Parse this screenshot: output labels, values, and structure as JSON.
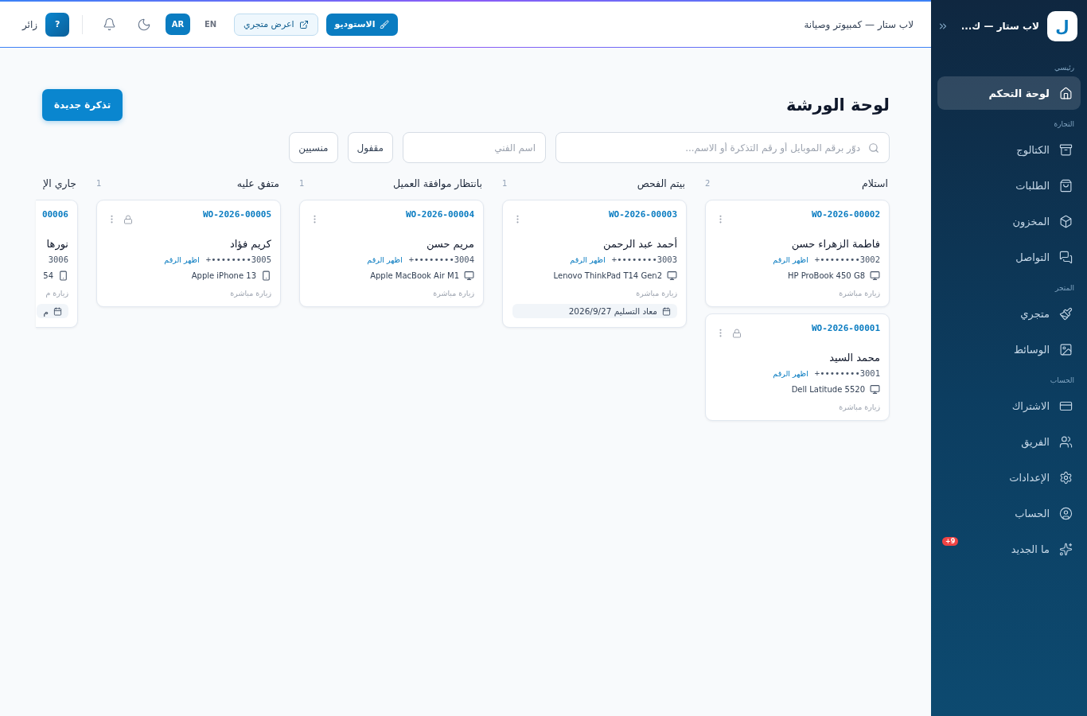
{
  "sidebar": {
    "logo": "ل",
    "title": "لاب ستار — ك...",
    "sections": [
      {
        "title": "رئيسي",
        "items": [
          {
            "label": "لوحة التحكم",
            "selected": true
          }
        ]
      },
      {
        "title": "التجارة",
        "items": [
          {
            "label": "الكتالوج",
            "selected": false
          },
          {
            "label": "الطلبات",
            "selected": false
          },
          {
            "label": "المخزون",
            "selected": false
          },
          {
            "label": "التواصل",
            "selected": false
          }
        ]
      },
      {
        "title": "المتجر",
        "items": [
          {
            "label": "متجري",
            "selected": false
          },
          {
            "label": "الوسائط",
            "selected": false
          }
        ]
      },
      {
        "title": "الحساب",
        "items": [
          {
            "label": "الاشتراك",
            "selected": false
          },
          {
            "label": "الفريق",
            "selected": false
          },
          {
            "label": "الإعدادات",
            "selected": false
          },
          {
            "label": "الحساب",
            "selected": false
          },
          {
            "label": "ما الجديد",
            "selected": false,
            "badge": "+9"
          }
        ]
      }
    ]
  },
  "topbar": {
    "title": "لاب ستار — كمبيوتر وصيانة",
    "studio_button": "الاستوديو",
    "store_button": "اعرض متجري",
    "languages": [
      {
        "label": "EN",
        "selected": false
      },
      {
        "label": "AR",
        "selected": true
      }
    ],
    "avatar": "?",
    "user": "زائر"
  },
  "page": {
    "heading": "لوحة الورشة",
    "new_button": "تذكرة جديدة",
    "search": {
      "placeholder": "دوّر برقم الموبايل أو رقم التذكرة أو الاسم..."
    },
    "technician": {
      "placeholder": "اسم الفني"
    },
    "filter_buttons": [
      "مقفول",
      "منسيين"
    ]
  },
  "columns": [
    {
      "kind": "full",
      "title": "استلام",
      "count": "2",
      "cards": [
        {
          "id": "WO-2026-00002",
          "customer": "فاطمة الزهراء حسن",
          "phone": "+••••••••3002",
          "reveal": "اظهر الرقم",
          "device": {
            "kind": "laptop",
            "name": "HP ProBook 450 G8"
          },
          "source": "زيارة مباشرة",
          "locked": false
        },
        {
          "id": "WO-2026-00001",
          "customer": "محمد السيد",
          "phone": "+••••••••3001",
          "reveal": "اظهر الرقم",
          "device": {
            "kind": "laptop",
            "name": "Dell Latitude 5520"
          },
          "source": "زيارة مباشرة",
          "locked": true
        }
      ]
    },
    {
      "kind": "full",
      "title": "بيتم الفحص",
      "count": "1",
      "cards": [
        {
          "id": "WO-2026-00003",
          "customer": "أحمد عبد الرحمن",
          "phone": "+••••••••3003",
          "reveal": "اظهر الرقم",
          "device": {
            "kind": "laptop",
            "name": "Lenovo ThinkPad T14 Gen2"
          },
          "source": "زيارة مباشرة",
          "locked": false,
          "due": "معاد التسليم 2026/9/27"
        }
      ]
    },
    {
      "kind": "full",
      "title": "بانتظار موافقة العميل",
      "count": "1",
      "cards": [
        {
          "id": "WO-2026-00004",
          "customer": "مريم حسن",
          "phone": "+••••••••3004",
          "reveal": "اظهر الرقم",
          "device": {
            "kind": "laptop",
            "name": "Apple MacBook Air M1"
          },
          "source": "زيارة مباشرة",
          "locked": false
        }
      ]
    },
    {
      "kind": "full",
      "title": "متفق عليه",
      "count": "1",
      "cards": [
        {
          "id": "WO-2026-00005",
          "customer": "كريم فؤاد",
          "phone": "+••••••••3005",
          "reveal": "اظهر الرقم",
          "device": {
            "kind": "phone",
            "name": "Apple iPhone 13"
          },
          "source": "زيارة مباشرة",
          "locked": true
        }
      ]
    },
    {
      "kind": "clipped",
      "title": "جاري الإ",
      "cards": [
        {
          "id": "00006",
          "customer": "نورها",
          "phone": "3006",
          "device": {
            "kind": "phone",
            "name": "54"
          },
          "source": "زيارة م",
          "due": "م"
        }
      ]
    }
  ]
}
